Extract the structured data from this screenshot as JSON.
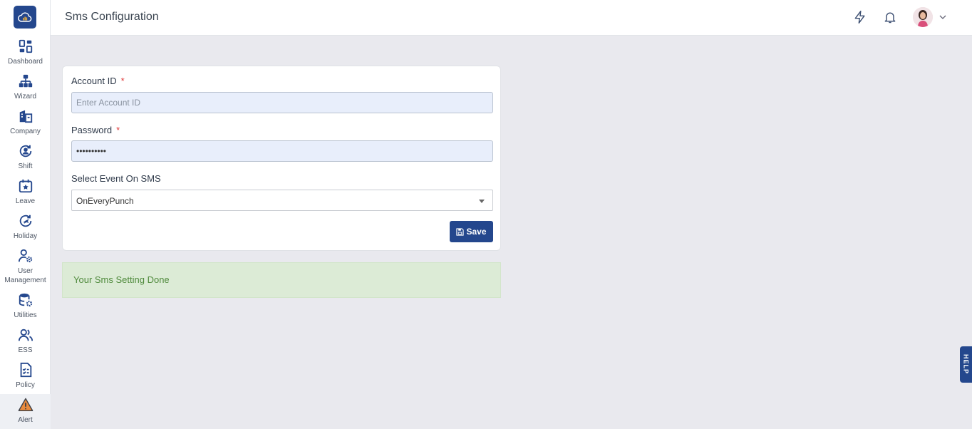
{
  "header": {
    "title": "Sms Configuration"
  },
  "sidebar": {
    "items": [
      {
        "label": "Dashboard",
        "icon": "dashboard-icon"
      },
      {
        "label": "Wizard",
        "icon": "hierarchy-icon"
      },
      {
        "label": "Company",
        "icon": "building-icon"
      },
      {
        "label": "Shift",
        "icon": "user-cycle-icon"
      },
      {
        "label": "Leave",
        "icon": "calendar-star-icon"
      },
      {
        "label": "Holiday",
        "icon": "plane-cycle-icon"
      },
      {
        "label": "User Management",
        "icon": "user-gear-icon"
      },
      {
        "label": "Utilities",
        "icon": "database-gear-icon"
      },
      {
        "label": "ESS",
        "icon": "users-icon"
      },
      {
        "label": "Policy",
        "icon": "checklist-icon"
      },
      {
        "label": "Alert",
        "icon": "warning-icon"
      }
    ],
    "active": "Alert"
  },
  "form": {
    "account_label": "Account ID",
    "account_value": "",
    "account_placeholder": "Enter Account ID",
    "password_label": "Password",
    "password_value": "••••••••••",
    "required_mark": "*",
    "event_label": "Select Event On SMS",
    "event_value": "OnEveryPunch",
    "save_label": "Save"
  },
  "alert": {
    "message": "Your Sms Setting Done"
  },
  "help": {
    "label": "HELP"
  },
  "colors": {
    "primary": "#24478d",
    "success_bg": "#dcebd6",
    "success_text": "#4f8a3c",
    "required": "#e03a3a"
  }
}
